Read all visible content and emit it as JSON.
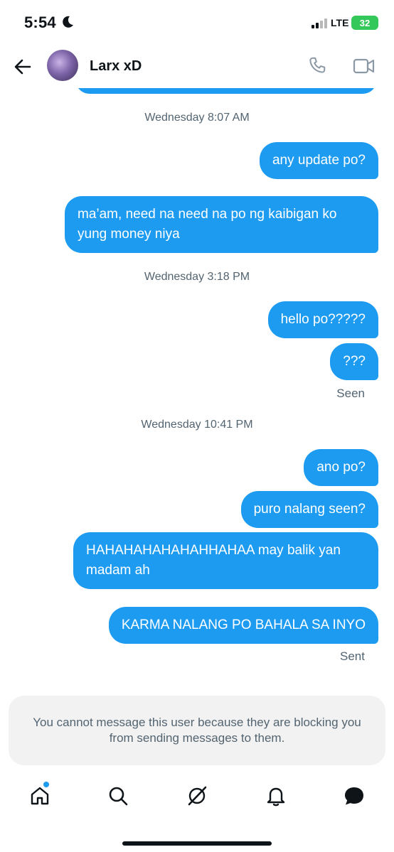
{
  "status": {
    "time": "5:54",
    "network": "LTE",
    "battery": "32"
  },
  "header": {
    "contact_name": "Larx xD"
  },
  "thread": {
    "stamp_1": "Wednesday 8:07 AM",
    "msg_1": "any update po?",
    "msg_2": "ma’am, need na need na po ng kaibigan ko yung money niya",
    "stamp_2": "Wednesday 3:18 PM",
    "msg_3": "hello po?????",
    "msg_4": "???",
    "receipt_seen": "Seen",
    "stamp_3": "Wednesday 10:41 PM",
    "msg_5": "ano po?",
    "msg_6": "puro nalang seen?",
    "msg_7": "HAHAHAHAHAHAHHAHAA may balik yan madam ah",
    "msg_8": "KARMA NALANG PO BAHALA SA INYO",
    "receipt_sent": "Sent"
  },
  "blocked_notice": "You cannot message this user because they are blocking you from sending messages to them.",
  "colors": {
    "accent": "#1d9bf0",
    "battery": "#34c759",
    "secondary_text": "#536471",
    "notice_bg": "#f2f2f2"
  },
  "tabs": [
    "home-icon",
    "search-icon",
    "grok-icon",
    "notifications-icon",
    "messages-icon"
  ]
}
